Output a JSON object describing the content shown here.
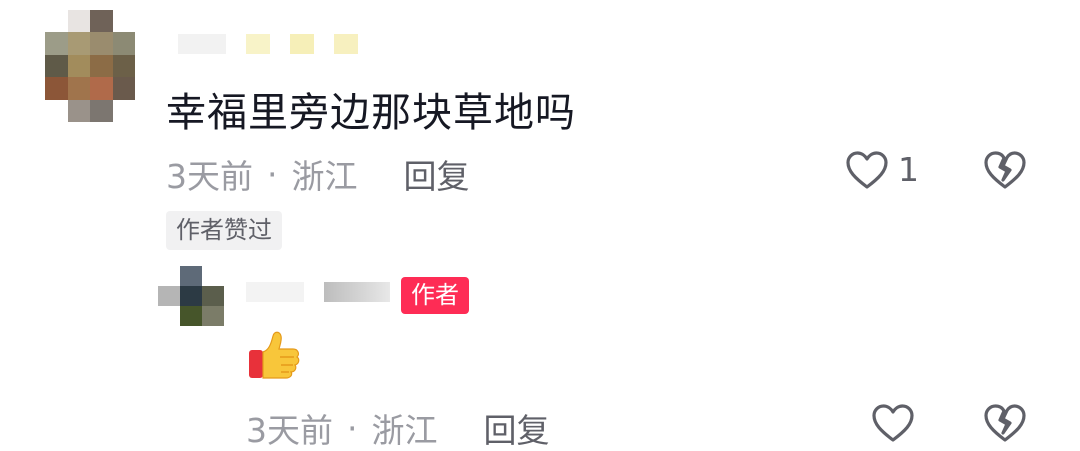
{
  "comment": {
    "text": "幸福里旁边那块草地吗",
    "time": "3天前",
    "separator": "·",
    "location": "浙江",
    "reply_label": "回复",
    "like_count": "1",
    "liked_badge": "作者赞过"
  },
  "reply": {
    "author_badge": "作者",
    "content_emoji": "thumbs-up-emoji",
    "time": "3天前",
    "separator": "·",
    "location": "浙江",
    "reply_label": "回复"
  },
  "colors": {
    "accent": "#fe2c55",
    "meta_text": "#9a9ba2",
    "icon_stroke": "#5f6068"
  }
}
